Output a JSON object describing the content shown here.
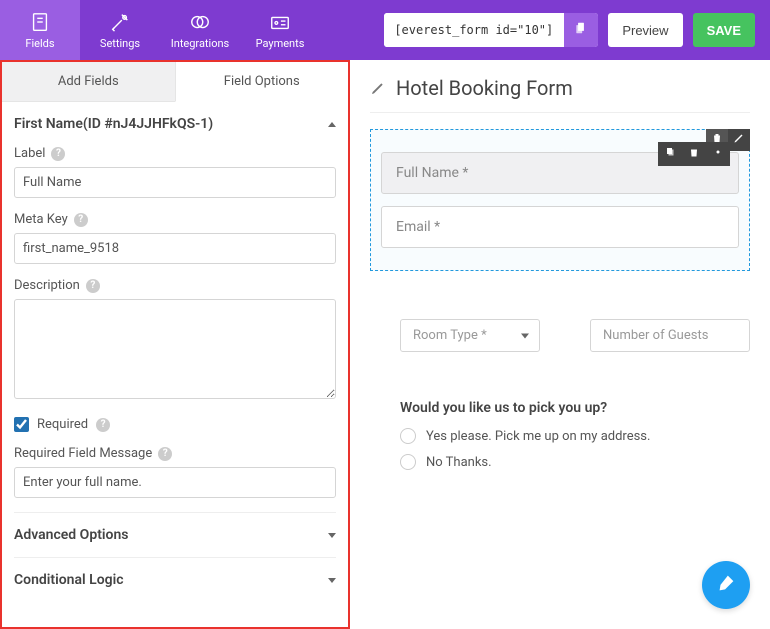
{
  "topbar": {
    "items": [
      {
        "label": "Fields"
      },
      {
        "label": "Settings"
      },
      {
        "label": "Integrations"
      },
      {
        "label": "Payments"
      }
    ],
    "shortcode": "[everest_form id=\"10\"]",
    "preview": "Preview",
    "save": "SAVE"
  },
  "tabs": {
    "add_fields": "Add Fields",
    "field_options": "Field Options"
  },
  "section": {
    "title": "First Name(ID #nJ4JJHFkQS-1)"
  },
  "fields": {
    "label": {
      "label": "Label",
      "value": "Full Name"
    },
    "meta_key": {
      "label": "Meta Key",
      "value": "first_name_9518"
    },
    "description": {
      "label": "Description",
      "value": ""
    },
    "required": {
      "label": "Required",
      "checked": true
    },
    "required_msg": {
      "label": "Required Field Message",
      "value": "Enter your full name."
    }
  },
  "collapse": {
    "advanced": "Advanced Options",
    "conditional": "Conditional Logic"
  },
  "form": {
    "title": "Hotel Booking Form",
    "fullname_placeholder": "Full Name *",
    "email_placeholder": "Email *",
    "room_type": "Room Type *",
    "guests": "Number of Guests",
    "pickup_question": "Would you like us to pick you up?",
    "opt_yes": "Yes please. Pick me up on my address.",
    "opt_no": "No Thanks."
  }
}
